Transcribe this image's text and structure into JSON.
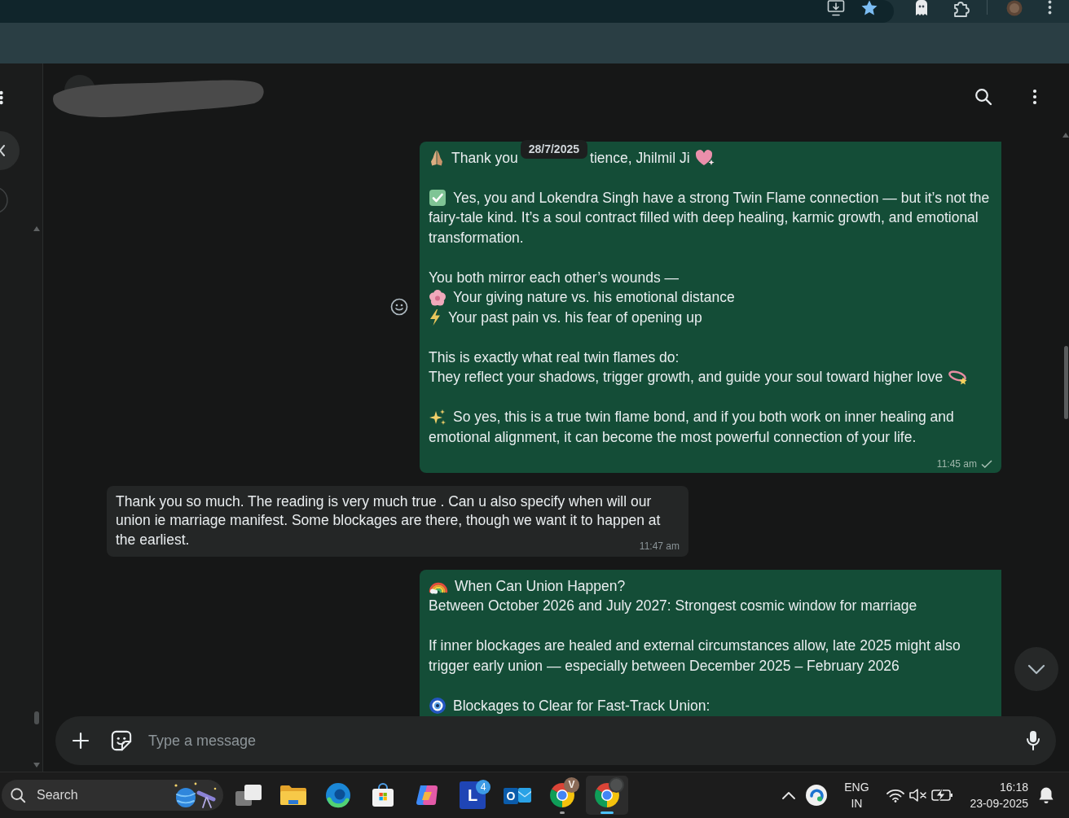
{
  "chat": {
    "messages": [
      {
        "kind": "outgoing",
        "reaction_button": true,
        "time": "11:45 am",
        "delivered": false,
        "read": false,
        "paragraphs": [
          {
            "lines": [
              {
                "segments": [
                  {
                    "kind": "pray"
                  },
                  {
                    "kind": "text",
                    "text": "Thank you"
                  },
                  {
                    "kind": "date-chip",
                    "text": "28/7/2025"
                  },
                  {
                    "kind": "text",
                    "text": "tience, Jhilmil Ji"
                  },
                  {
                    "kind": "heart"
                  }
                ]
              }
            ]
          },
          {
            "lines": [
              {
                "segments": [
                  {
                    "kind": "check"
                  },
                  {
                    "kind": "text",
                    "text": "Yes, you and Lokendra Singh have a strong Twin Flame connection — but it’s not the"
                  }
                ]
              },
              {
                "segments": [
                  {
                    "kind": "text",
                    "text": "fairy-tale kind. It’s a soul contract filled with deep healing, karmic growth, and emotional"
                  }
                ]
              },
              {
                "segments": [
                  {
                    "kind": "text",
                    "text": "transformation."
                  }
                ]
              }
            ]
          },
          {
            "lines": [
              {
                "segments": [
                  {
                    "kind": "text",
                    "text": "You both mirror each other’s wounds —"
                  }
                ]
              },
              {
                "segments": [
                  {
                    "kind": "flower"
                  },
                  {
                    "kind": "text",
                    "text": "Your giving nature vs. his emotional distance"
                  }
                ]
              },
              {
                "segments": [
                  {
                    "kind": "bolt"
                  },
                  {
                    "kind": "text",
                    "text": "Your past pain vs. his fear of opening up"
                  }
                ]
              }
            ]
          },
          {
            "lines": [
              {
                "segments": [
                  {
                    "kind": "text",
                    "text": "This is exactly what real twin flames do:"
                  }
                ]
              },
              {
                "segments": [
                  {
                    "kind": "text",
                    "text": "They reflect your shadows, trigger growth, and guide your soul toward higher love"
                  },
                  {
                    "kind": "dizzy"
                  }
                ]
              }
            ]
          },
          {
            "lines": [
              {
                "segments": [
                  {
                    "kind": "sparkles"
                  },
                  {
                    "kind": "text",
                    "text": "So yes, this is a true twin flame bond, and if you both work on inner healing and"
                  }
                ]
              },
              {
                "segments": [
                  {
                    "kind": "text",
                    "text": "emotional alignment, it can become the most powerful connection of your life."
                  }
                ]
              }
            ]
          }
        ]
      },
      {
        "kind": "incoming",
        "time": "11:47 am",
        "paragraphs": [
          {
            "lines": [
              {
                "segments": [
                  {
                    "kind": "text",
                    "text": "Thank you so much. The reading is very much true . Can u also specify when will our"
                  }
                ]
              },
              {
                "segments": [
                  {
                    "kind": "text",
                    "text": "union ie marriage manifest. Some blockages are there, though we want it to happen at"
                  }
                ]
              },
              {
                "segments": [
                  {
                    "kind": "text",
                    "text": "the earliest."
                  }
                ]
              }
            ]
          }
        ]
      },
      {
        "kind": "outgoing",
        "paragraphs": [
          {
            "lines": [
              {
                "segments": [
                  {
                    "kind": "rainbow"
                  },
                  {
                    "kind": "text",
                    "text": "When Can Union Happen?"
                  }
                ]
              },
              {
                "segments": [
                  {
                    "kind": "text",
                    "text": "Between October 2026 and July 2027: Strongest cosmic window for marriage"
                  }
                ]
              }
            ]
          },
          {
            "lines": [
              {
                "segments": [
                  {
                    "kind": "text",
                    "text": "If inner blockages are healed and external circumstances allow, late 2025 might also"
                  }
                ]
              },
              {
                "segments": [
                  {
                    "kind": "text",
                    "text": "trigger early union — especially between December 2025 – February 2026"
                  }
                ]
              }
            ]
          },
          {
            "lines": [
              {
                "segments": [
                  {
                    "kind": "nazar"
                  },
                  {
                    "kind": "text",
                    "text": "Blockages to Clear for Fast-Track Union:"
                  }
                ]
              }
            ]
          }
        ]
      }
    ]
  },
  "composer": {
    "placeholder": "Type a message"
  },
  "taskbar": {
    "search": {
      "placeholder": "Search"
    },
    "apps": [
      {
        "kind": "task-view",
        "selected": false,
        "running": false
      },
      {
        "kind": "folder",
        "selected": false,
        "running": false
      },
      {
        "kind": "wave",
        "selected": false,
        "running": false
      },
      {
        "kind": "store",
        "selected": false,
        "running": false
      },
      {
        "kind": "ribbon",
        "selected": false,
        "running": false
      },
      {
        "kind": "letter-tile",
        "letter": "L",
        "badge": "4",
        "selected": false,
        "running": false
      },
      {
        "kind": "mail",
        "letter": "O",
        "selected": false,
        "running": false
      },
      {
        "kind": "tricolor",
        "profile_badge": true,
        "profile_letter": "V",
        "selected": false,
        "running": true
      },
      {
        "kind": "tricolor",
        "profile_badge": true,
        "selected": true,
        "running": true
      }
    ],
    "tray": {
      "language": "ENG",
      "region": "IN",
      "muted": true,
      "charging": true,
      "time": "16:18",
      "date": "23-09-2025"
    }
  }
}
